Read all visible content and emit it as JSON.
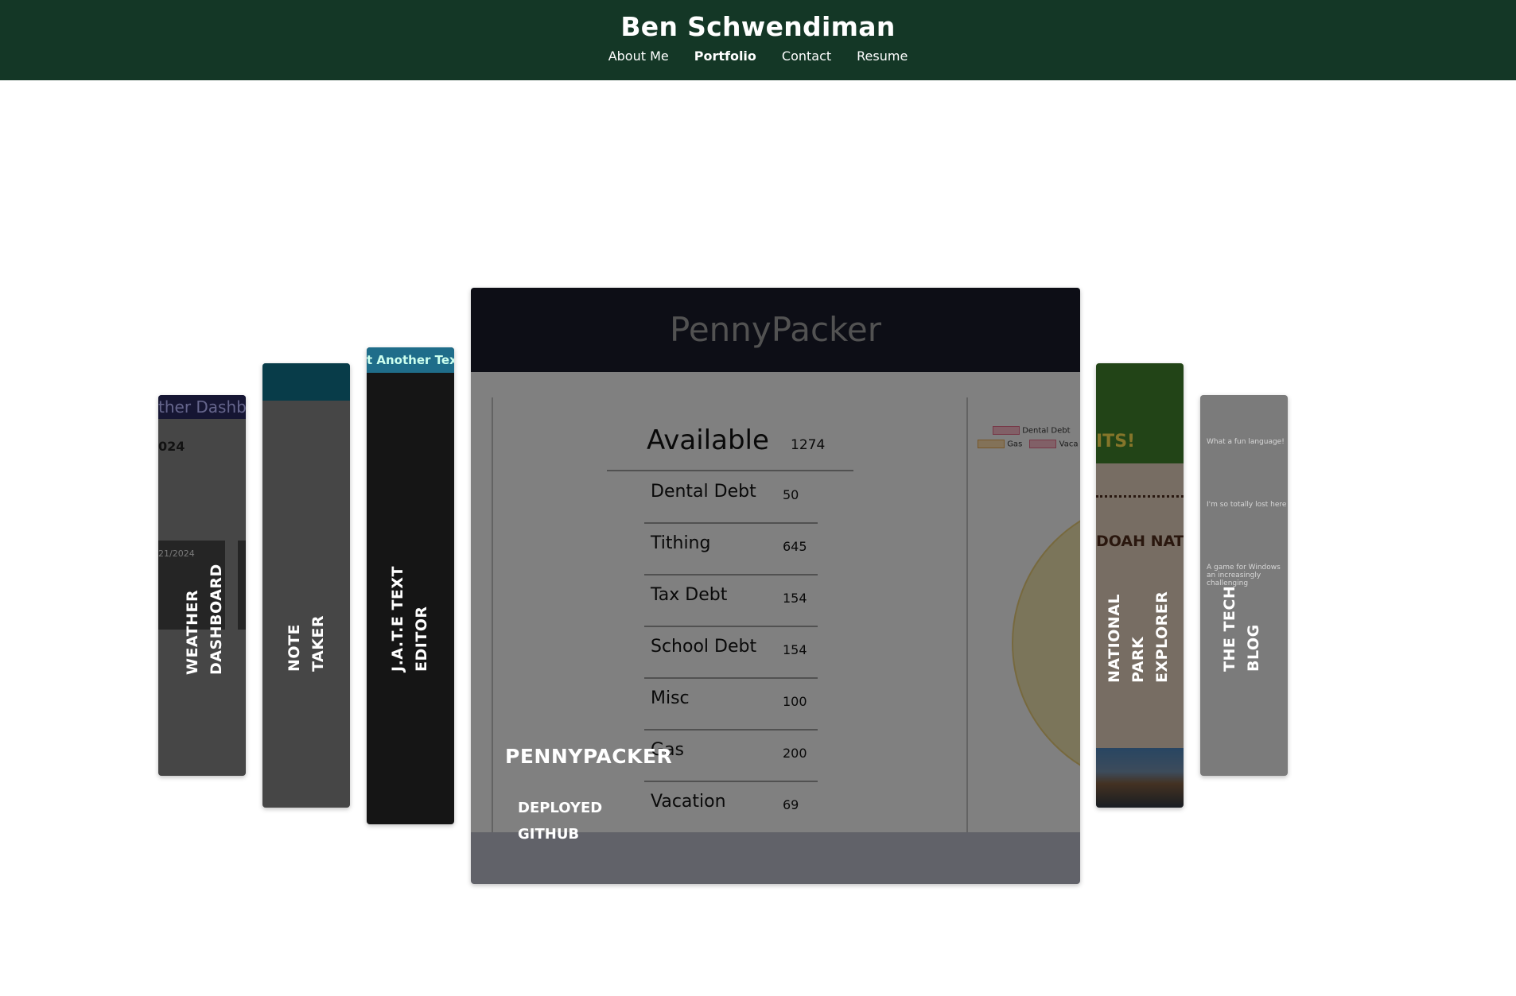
{
  "header": {
    "title": "Ben Schwendiman",
    "nav": [
      "About Me",
      "Portfolio",
      "Contact",
      "Resume"
    ],
    "active_nav": "Portfolio"
  },
  "projects": {
    "weather": {
      "label_line1": "WEATHER",
      "label_line2": "DASHBOARD",
      "screenshot_header": "ther Dashb",
      "screenshot_date": "024",
      "screenshot_card_date": "21/2024"
    },
    "note": {
      "label_line1": "NOTE",
      "label_line2": "TAKER"
    },
    "jate": {
      "label_line1": "J.A.T.E TEXT",
      "label_line2": "EDITOR",
      "screenshot_header": "t Another Text"
    },
    "penny": {
      "title": "PENNYPACKER",
      "deployed": "DEPLOYED",
      "github": "GITHUB",
      "screenshot_title": "PennyPacker",
      "available_label": "Available",
      "available_value": "1274",
      "rows": [
        {
          "label": "Dental Debt",
          "value": "50"
        },
        {
          "label": "Tithing",
          "value": "645"
        },
        {
          "label": "Tax Debt",
          "value": "154"
        },
        {
          "label": "School Debt",
          "value": "154"
        },
        {
          "label": "Misc",
          "value": "100"
        },
        {
          "label": "Gas",
          "value": "200"
        },
        {
          "label": "Vacation",
          "value": "69"
        }
      ],
      "legend": [
        "Dental Debt",
        "Gas",
        "Vaca"
      ]
    },
    "park": {
      "label_line1": "NATIONAL",
      "label_line2": "PARK",
      "label_line3": "EXPLORER",
      "screenshot_head": "ITS!",
      "screenshot_sub": "DOAH NATIO"
    },
    "blog": {
      "label_line1": "THE TECH",
      "label_line2": "BLOG",
      "post1": "What a fun language!",
      "post2": "I'm so totally lost here",
      "post3": "A game for Windows an increasingly challenging"
    }
  },
  "colors": {
    "header_bg": "#143726",
    "penny_topbar": "#1a1c2a"
  }
}
